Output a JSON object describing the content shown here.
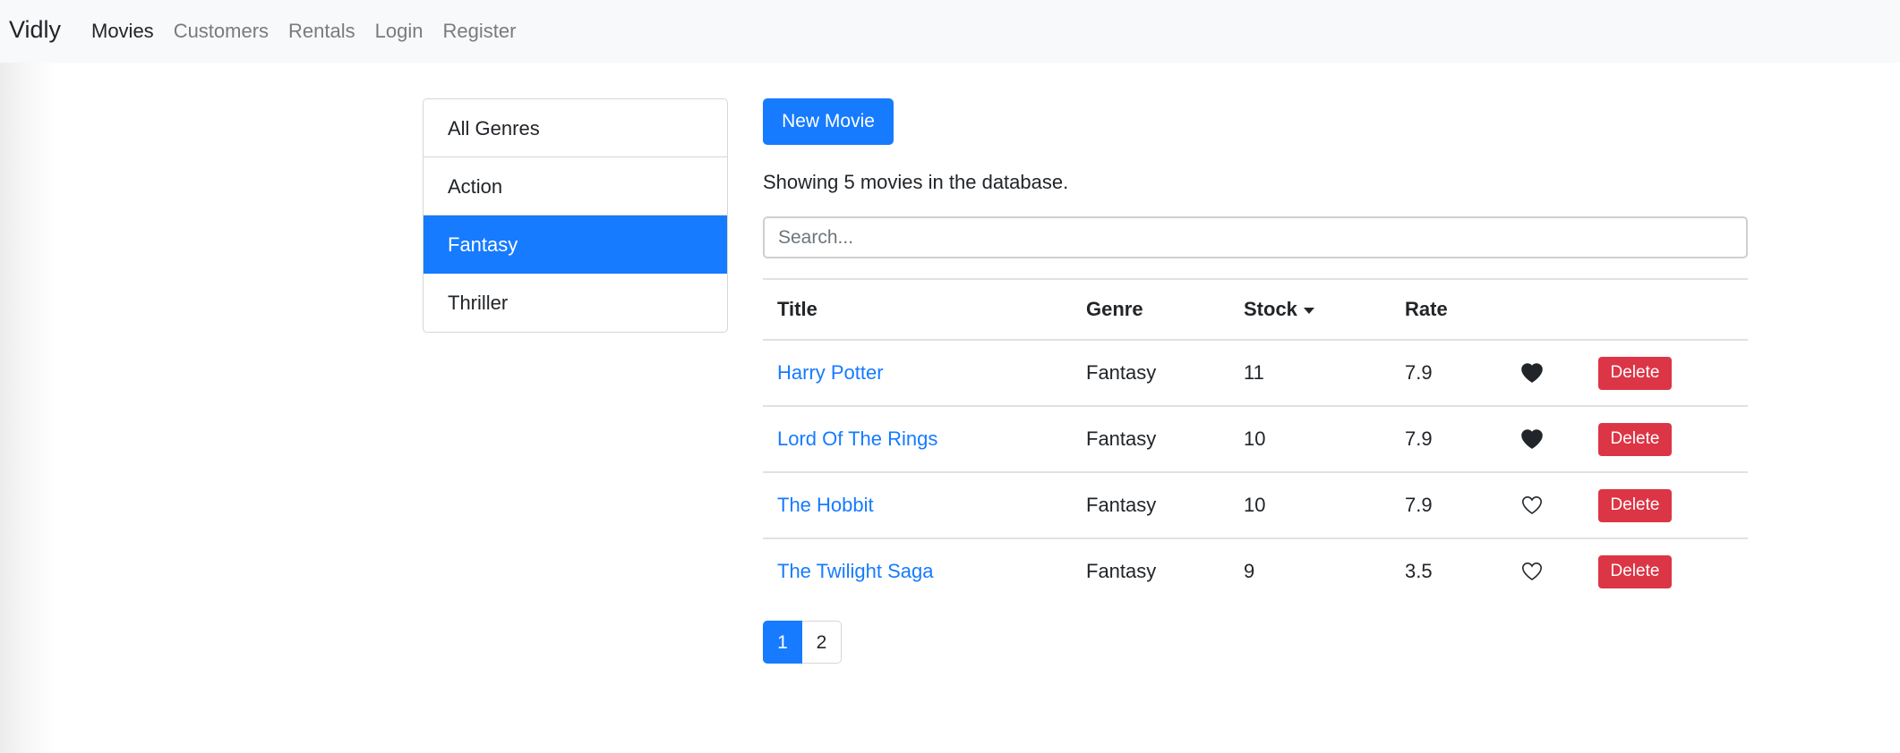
{
  "nav": {
    "brand": "Vidly",
    "links": [
      {
        "label": "Movies",
        "active": true
      },
      {
        "label": "Customers",
        "active": false
      },
      {
        "label": "Rentals",
        "active": false
      },
      {
        "label": "Login",
        "active": false
      },
      {
        "label": "Register",
        "active": false
      }
    ]
  },
  "genres": {
    "items": [
      {
        "label": "All Genres",
        "active": false
      },
      {
        "label": "Action",
        "active": false
      },
      {
        "label": "Fantasy",
        "active": true
      },
      {
        "label": "Thriller",
        "active": false
      }
    ]
  },
  "main": {
    "new_movie_label": "New Movie",
    "count_text": "Showing 5 movies in the database.",
    "search_placeholder": "Search...",
    "search_value": ""
  },
  "table": {
    "headers": {
      "title": "Title",
      "genre": "Genre",
      "stock": "Stock",
      "rate": "Rate"
    },
    "sort_column": "stock",
    "sort_direction": "descending",
    "sort_icon": "caret-down-icon",
    "rows": [
      {
        "title": "Harry Potter",
        "genre": "Fantasy",
        "stock": "11",
        "rate": "7.9",
        "liked": true,
        "delete_label": "Delete"
      },
      {
        "title": "Lord Of The Rings",
        "genre": "Fantasy",
        "stock": "10",
        "rate": "7.9",
        "liked": true,
        "delete_label": "Delete"
      },
      {
        "title": "The Hobbit",
        "genre": "Fantasy",
        "stock": "10",
        "rate": "7.9",
        "liked": false,
        "delete_label": "Delete"
      },
      {
        "title": "The Twilight Saga",
        "genre": "Fantasy",
        "stock": "9",
        "rate": "3.5",
        "liked": false,
        "delete_label": "Delete"
      }
    ]
  },
  "pagination": {
    "pages": [
      {
        "label": "1",
        "active": true
      },
      {
        "label": "2",
        "active": false
      }
    ]
  },
  "colors": {
    "primary": "#167bff",
    "danger": "#dc3545",
    "navbar_bg": "#f8f9fa",
    "text": "#212529",
    "muted_nav": "#7b7b7b"
  }
}
